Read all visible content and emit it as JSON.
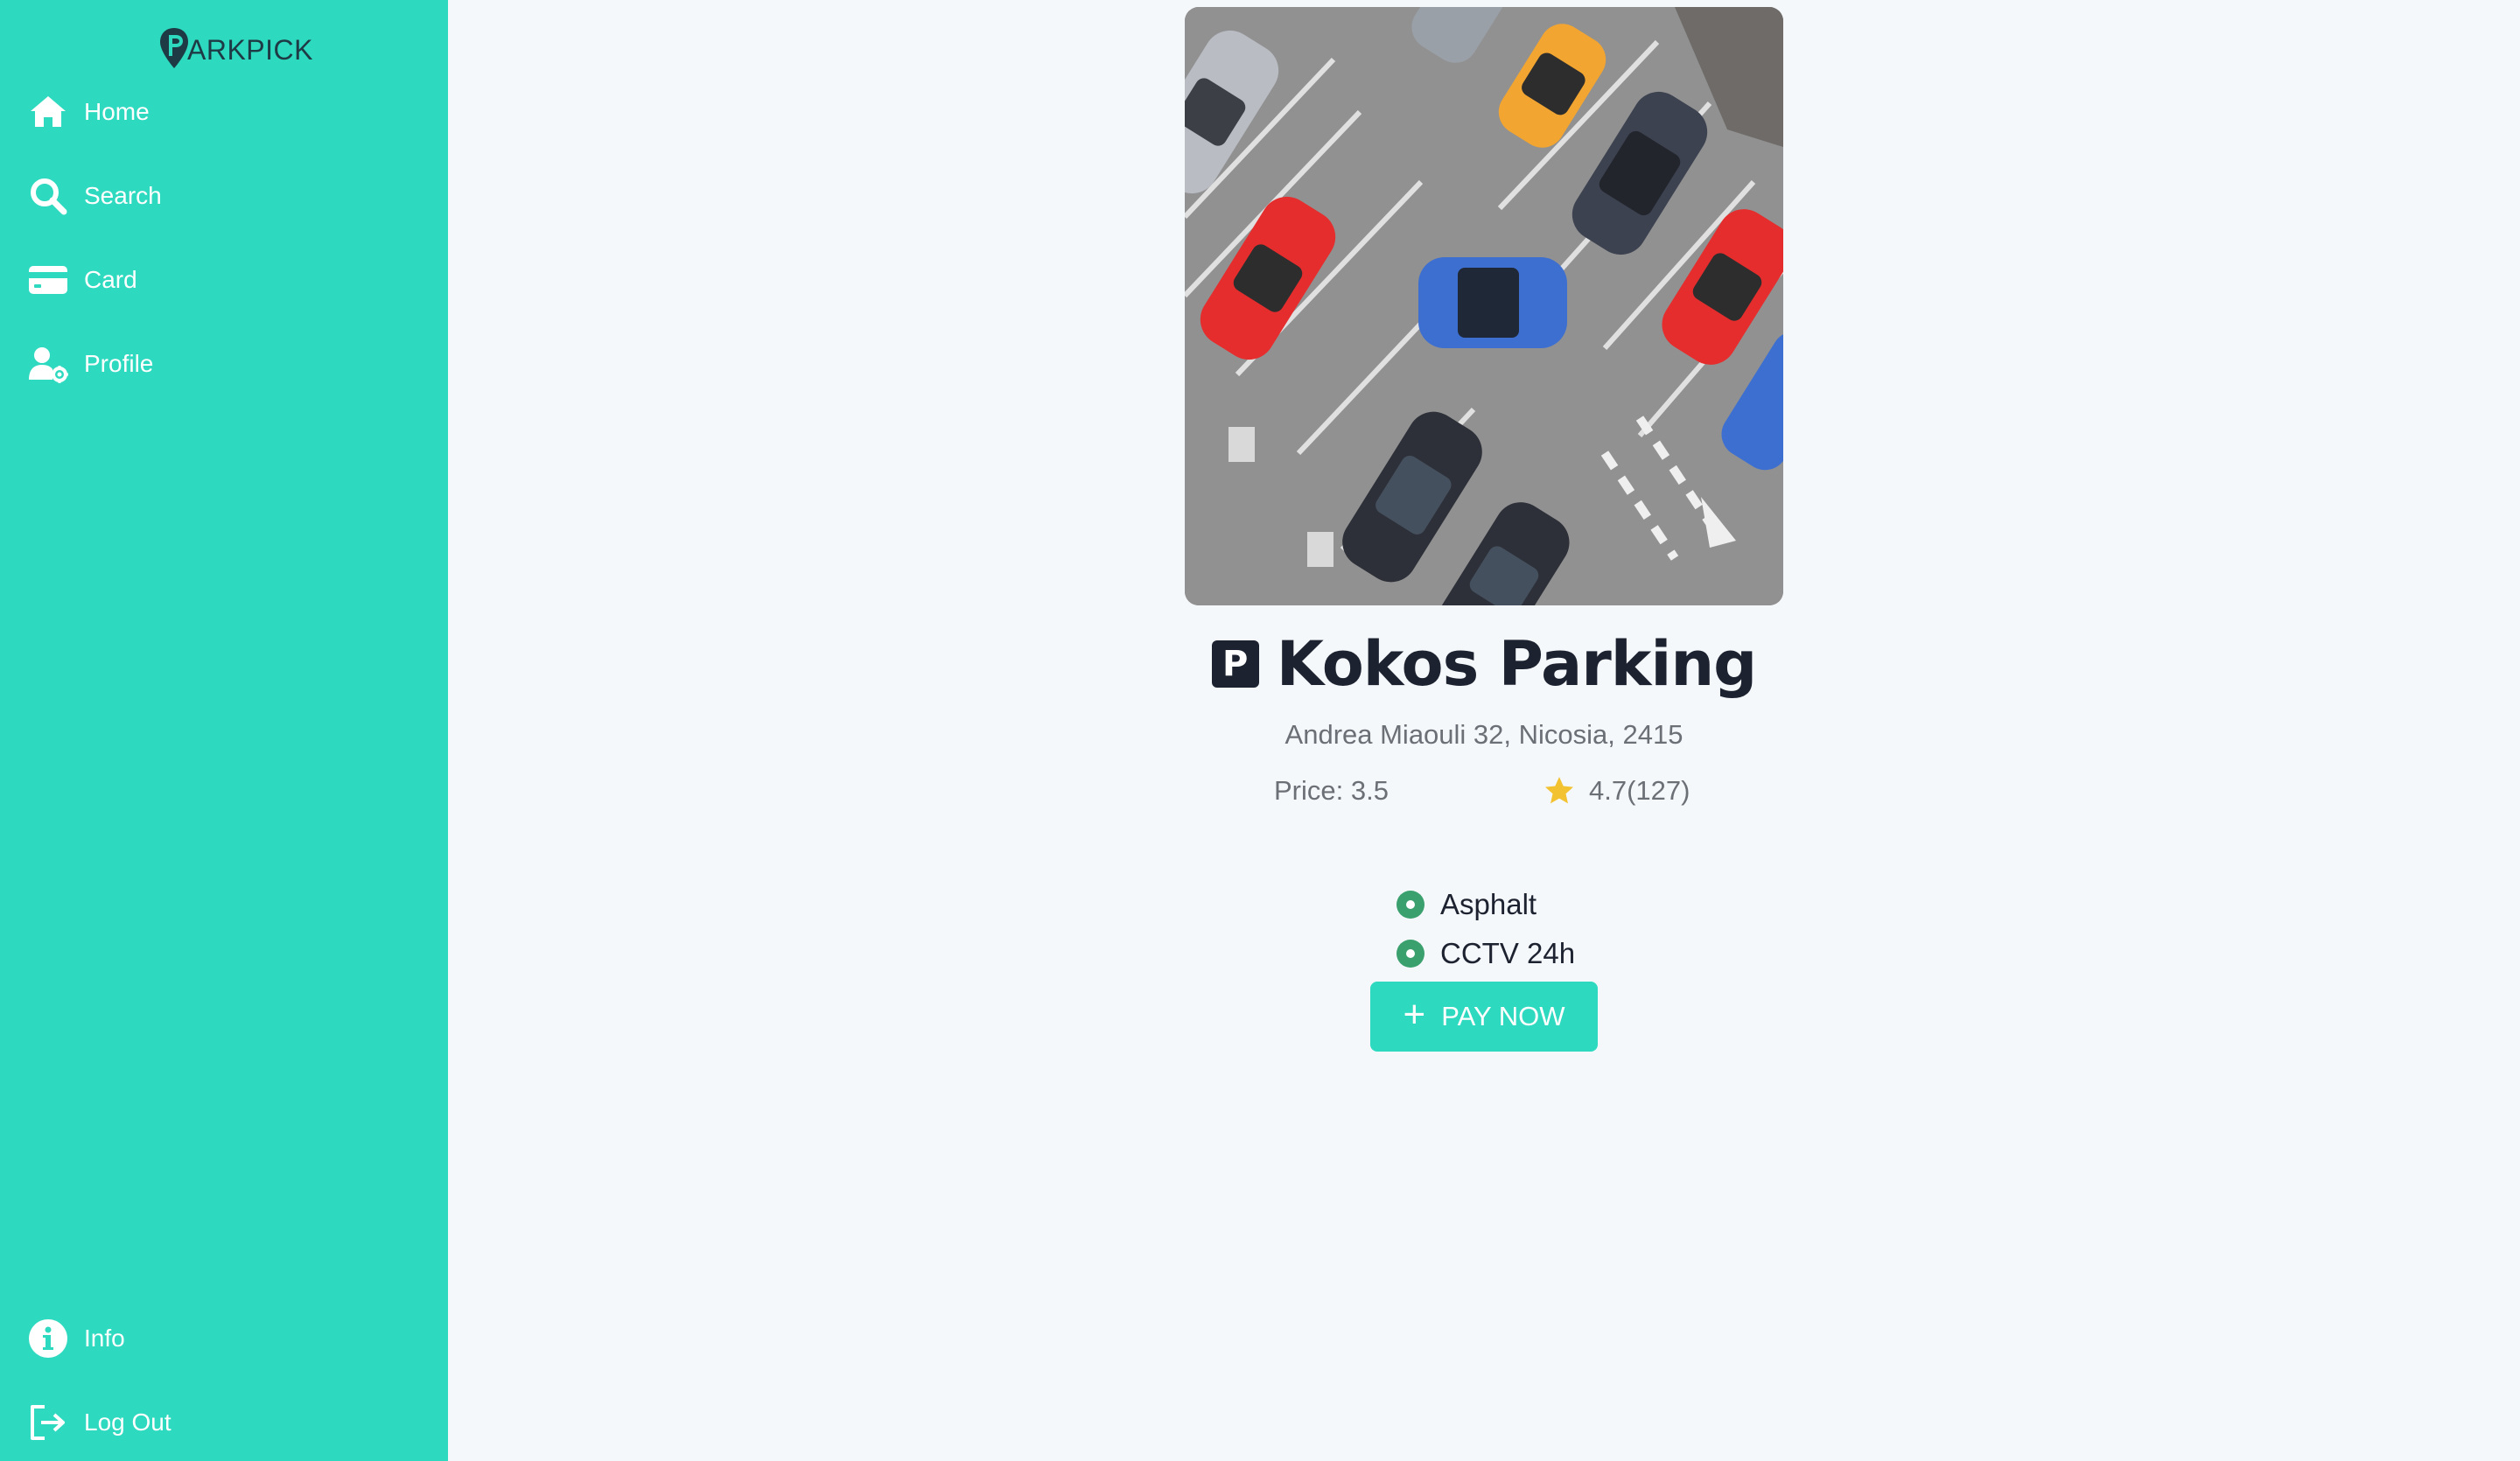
{
  "brand": {
    "logo_text": "ARKPICK",
    "logo_letter": "P"
  },
  "sidebar": {
    "top_items": [
      {
        "label": "Home",
        "icon": "home-icon"
      },
      {
        "label": "Search",
        "icon": "search-icon"
      },
      {
        "label": "Card",
        "icon": "credit-card-icon"
      },
      {
        "label": "Profile",
        "icon": "user-settings-icon"
      }
    ],
    "bottom_items": [
      {
        "label": "Info",
        "icon": "info-icon"
      },
      {
        "label": "Log Out",
        "icon": "logout-icon"
      }
    ]
  },
  "parking": {
    "image_alt": "aerial parking lot",
    "badge": "P",
    "name": "Kokos Parking",
    "address": "Andrea Miaouli 32, Nicosia, 2415",
    "price_text": "Price: 3.5",
    "rating_text": "4.7(127)",
    "rating": 4.7,
    "reviews": 127,
    "features": [
      "Asphalt",
      "CCTV 24h"
    ],
    "pay_label": "PAY NOW"
  },
  "colors": {
    "accent": "#2dd9bf",
    "background": "#f5f8fb",
    "text_dark": "#1d2230",
    "feature_dot": "#3aa06e",
    "star": "#f2c230"
  }
}
